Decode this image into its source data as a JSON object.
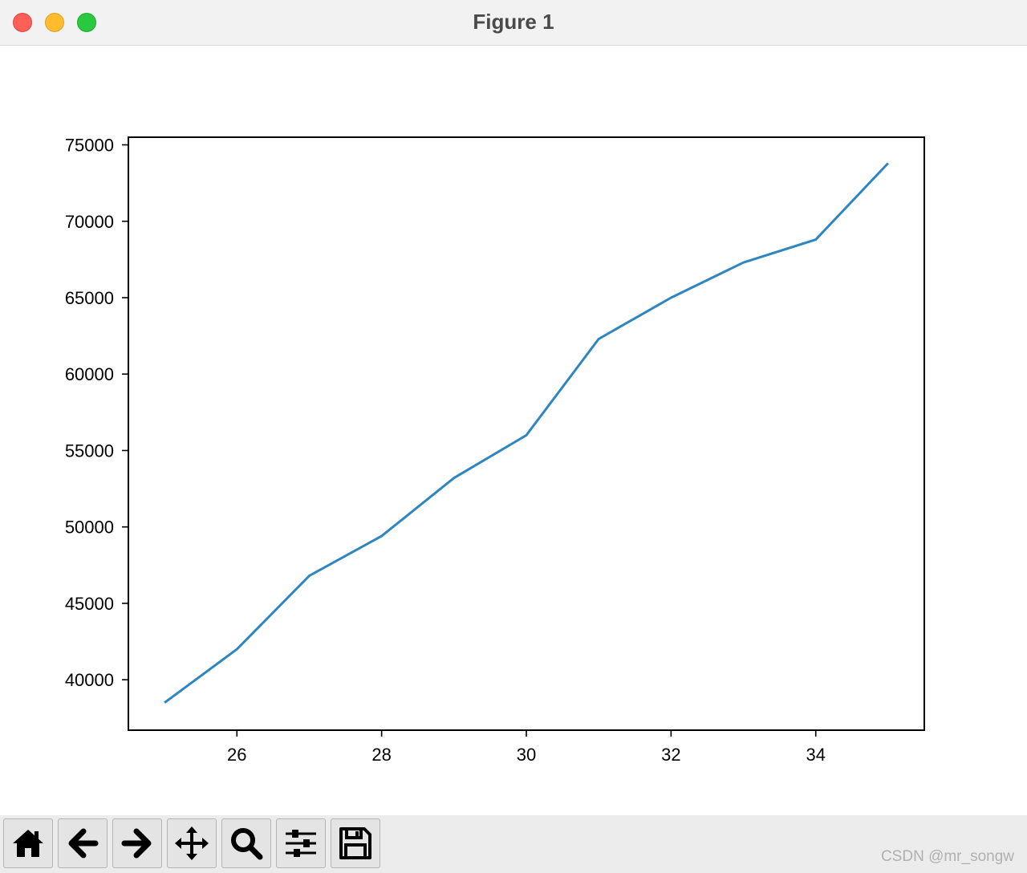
{
  "window": {
    "title": "Figure 1"
  },
  "chart_data": {
    "type": "line",
    "title": "",
    "xlabel": "",
    "ylabel": "",
    "x": [
      25,
      26,
      27,
      28,
      29,
      30,
      31,
      32,
      33,
      34,
      35
    ],
    "series": [
      {
        "values": [
          38500,
          42000,
          46800,
          49400,
          53200,
          56000,
          62300,
          65000,
          67300,
          68800,
          73800
        ],
        "color": "#2e86c1"
      }
    ],
    "xlim": [
      24.5,
      35.5
    ],
    "ylim": [
      36700,
      75500
    ],
    "xticks": [
      26,
      28,
      30,
      32,
      34
    ],
    "xtick_labels": [
      "26",
      "28",
      "30",
      "32",
      "34"
    ],
    "yticks": [
      40000,
      45000,
      50000,
      55000,
      60000,
      65000,
      70000,
      75000
    ],
    "ytick_labels": [
      "40000",
      "45000",
      "50000",
      "55000",
      "60000",
      "65000",
      "70000",
      "75000"
    ],
    "grid": false,
    "legend": "none"
  },
  "toolbar": {
    "buttons": [
      {
        "icon": "home-icon"
      },
      {
        "icon": "back-arrow-icon"
      },
      {
        "icon": "forward-arrow-icon"
      },
      {
        "icon": "move-icon"
      },
      {
        "icon": "zoom-icon"
      },
      {
        "icon": "sliders-icon"
      },
      {
        "icon": "save-icon"
      }
    ]
  },
  "watermark": "CSDN @mr_songw"
}
